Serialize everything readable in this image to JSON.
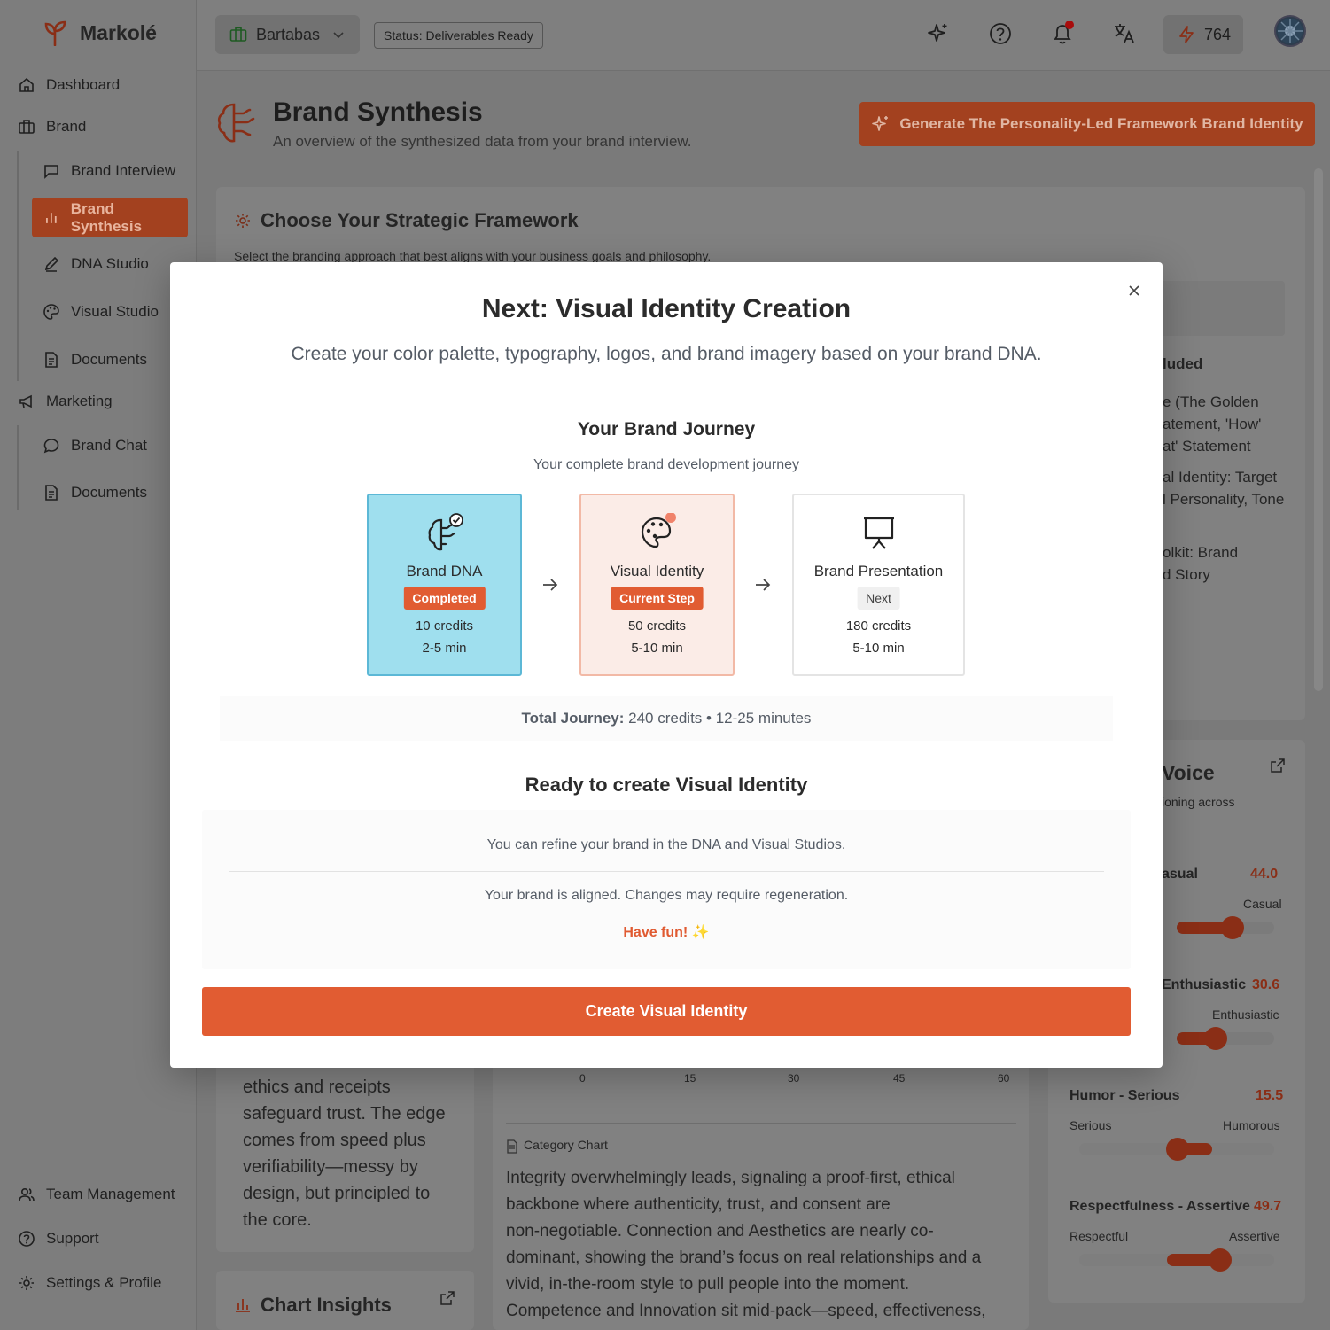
{
  "app": {
    "name": "Markolé"
  },
  "sidebar": {
    "items": [
      {
        "label": "Dashboard"
      },
      {
        "label": "Brand"
      },
      {
        "label": "Brand Interview"
      },
      {
        "label": "Brand Synthesis"
      },
      {
        "label": "DNA Studio"
      },
      {
        "label": "Visual Studio"
      },
      {
        "label": "Documents"
      },
      {
        "label": "Marketing"
      },
      {
        "label": "Brand Chat"
      },
      {
        "label": "Documents"
      }
    ],
    "bottom": [
      {
        "label": "Team Management"
      },
      {
        "label": "Support"
      },
      {
        "label": "Settings & Profile"
      }
    ]
  },
  "topbar": {
    "workspace": "Bartabas",
    "status": "Status: Deliverables Ready",
    "credits": "764"
  },
  "page": {
    "title": "Brand Synthesis",
    "subtitle": "An overview of the synthesized data from your brand interview.",
    "generate_button": "Generate The Personality-Led Framework Brand Identity"
  },
  "framework_card": {
    "title": "Choose Your Strategic Framework",
    "subtitle": "Select the branding approach that best aligns with your business goals and philosophy.",
    "included_title": "luded",
    "included_lines": [
      "e (The Golden",
      "atement, 'How'",
      "at' Statement",
      "al Identity: Target",
      "l Personality, Tone",
      "olkit: Brand",
      "d Story"
    ]
  },
  "voice_card": {
    "title": "Voice",
    "subtitle": "ioning across",
    "sliders": [
      {
        "name": "asual",
        "value": "44.0",
        "left": "",
        "right": "Casual",
        "level": 0.44
      },
      {
        "name": "Enthusiastic",
        "value": "30.6",
        "left": "",
        "right": "Enthusiastic",
        "level": 0.306
      },
      {
        "name": "Humor - Serious",
        "value": "15.5",
        "left": "Serious",
        "right": "Humorous",
        "level": 0.155
      },
      {
        "name": "Respectfulness - Assertive",
        "value": "49.7",
        "left": "Respectful",
        "right": "Assertive",
        "level": 0.497
      }
    ]
  },
  "story_card": {
    "text_lines": [
      "ethics and receipts",
      "safeguard trust. The edge",
      "comes from speed plus",
      "verifiability—messy by",
      "design, but principled to",
      "the core."
    ]
  },
  "chart_insights": {
    "title": "Chart Insights"
  },
  "category_chart": {
    "axis_ticks": [
      "0",
      "15",
      "30",
      "45",
      "60"
    ],
    "label": "Category Chart",
    "text_lines": [
      "Integrity overwhelmingly leads, signaling a proof-first, ethical",
      "backbone where authenticity, trust, and consent are",
      "non-negotiable. Connection and Aesthetics are nearly co-",
      "dominant, showing the brand’s focus on real relationships and a",
      "vivid, in-the-room style to pull people into the moment.",
      "Competence and Innovation sit mid-pack—speed, effectiveness,"
    ]
  },
  "modal": {
    "title": "Next: Visual Identity Creation",
    "subtitle": "Create your color palette, typography, logos, and brand imagery based on your brand DNA.",
    "journey_title": "Your Brand Journey",
    "journey_subtitle": "Your complete brand development journey",
    "steps": [
      {
        "name": "Brand DNA",
        "badge": "Completed",
        "credits": "10 credits",
        "time": "2-5 min"
      },
      {
        "name": "Visual Identity",
        "badge": "Current Step",
        "credits": "50 credits",
        "time": "5-10 min"
      },
      {
        "name": "Brand Presentation",
        "badge": "Next",
        "credits": "180 credits",
        "time": "5-10 min"
      }
    ],
    "total_label": "Total Journey:",
    "total_value": " 240 credits • 12-25 minutes",
    "ready_title": "Ready to create Visual Identity",
    "info_line1": "You can refine your brand in the DNA and Visual Studios.",
    "info_line2": "Your brand is aligned. Changes may require regeneration.",
    "fun": "Have fun! ✨",
    "cta": "Create Visual Identity"
  },
  "colors": {
    "accent": "#e15c32",
    "completed_bg": "#9fdfee",
    "current_bg": "#fbece7"
  }
}
